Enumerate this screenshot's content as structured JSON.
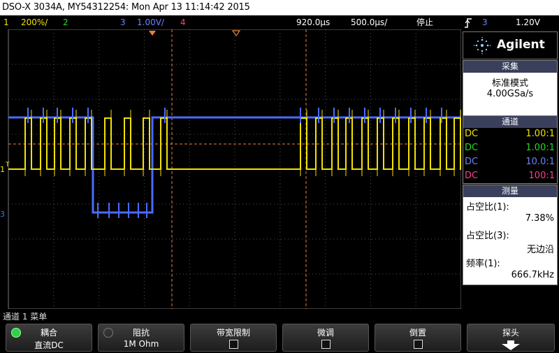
{
  "title": "DSO-X 3034A, MY54312254: Mon Apr 13 11:14:42 2015",
  "status": {
    "ch1_num": "1",
    "ch1_scale": "200%/",
    "ch2_num": "2",
    "ch3_num": "3",
    "ch3_scale": "1.00V/",
    "ch4_num": "4",
    "time_delay": "920.0μs",
    "time_scale": "500.0μs/",
    "run_state": "停止",
    "trigger_icon": "rising-edge-trigger-icon",
    "trig_ch": "3",
    "trig_level": "1.20V"
  },
  "colors": {
    "ch1": "#f2e200",
    "ch2": "#22dd22",
    "ch3": "#4a6cff",
    "ch4": "#ff3d8f",
    "cursor": "#e8823a"
  },
  "brand": "Agilent",
  "acquire": {
    "title": "采集",
    "mode": "标准模式",
    "rate": "4.00GSa/s"
  },
  "channels": {
    "title": "通道",
    "rows": [
      {
        "coupling": "DC",
        "probe": "1.00:1"
      },
      {
        "coupling": "DC",
        "probe": "1.00:1"
      },
      {
        "coupling": "DC",
        "probe": "10.0:1"
      },
      {
        "coupling": "DC",
        "probe": "100:1"
      }
    ]
  },
  "measure": {
    "title": "测量",
    "m1_label": "占空比(1):",
    "m1_value": "7.38%",
    "m2_label": "占空比(3):",
    "m2_value": "无边沿",
    "m3_label": "频率(1):",
    "m3_value": "666.7kHz"
  },
  "menu_label": "通道 1 菜单",
  "softkeys": [
    {
      "top": "耦合",
      "bottom": "直流DC"
    },
    {
      "top": "阻抗",
      "bottom": "1M Ohm"
    },
    {
      "top": "带宽限制",
      "bottom": ""
    },
    {
      "top": "微调",
      "bottom": ""
    },
    {
      "top": "倒置",
      "bottom": ""
    },
    {
      "top": "探头",
      "bottom": ""
    }
  ],
  "markers": {
    "ch1": "1",
    "ch3": "3",
    "trigger": "T"
  }
}
